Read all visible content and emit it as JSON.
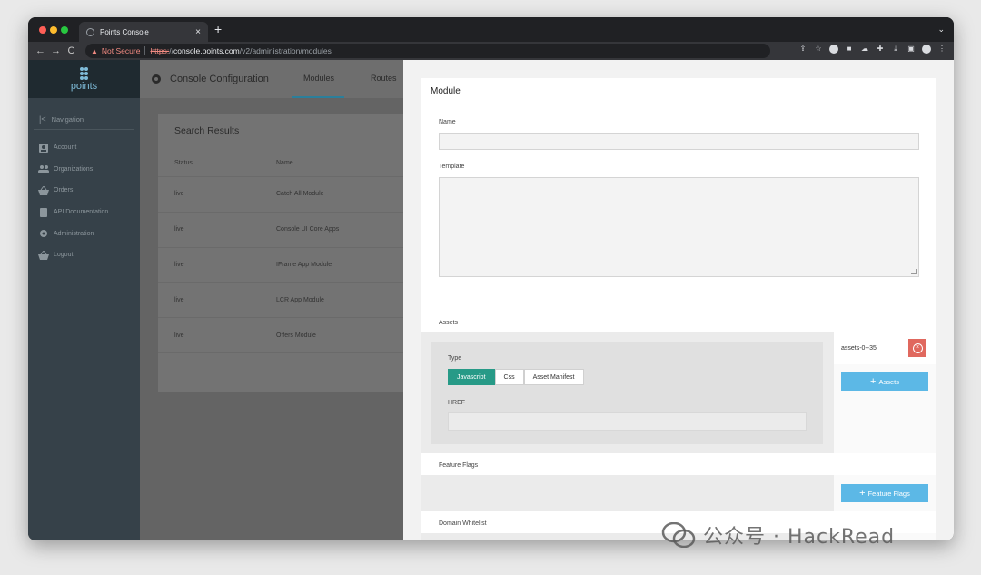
{
  "browser": {
    "tab_title": "Points Console",
    "tab_close": "×",
    "new_tab": "+",
    "tab_menu": "⌄",
    "back": "←",
    "forward": "→",
    "reload": "C",
    "security_text": "Not Secure",
    "url_scheme": "https:",
    "url_sep": "//",
    "url_host": "console.points.com",
    "url_path": "/v2/administration/modules"
  },
  "sidebar": {
    "logo_text": "points",
    "nav_label": "Navigation",
    "items": [
      {
        "label": "Account",
        "icon": "account-icon"
      },
      {
        "label": "Organizations",
        "icon": "organizations-icon"
      },
      {
        "label": "Orders",
        "icon": "orders-icon"
      },
      {
        "label": "API Documentation",
        "icon": "documentation-icon"
      },
      {
        "label": "Administration",
        "icon": "gear-icon"
      },
      {
        "label": "Logout",
        "icon": "logout-icon"
      }
    ]
  },
  "header": {
    "title": "Console Configuration",
    "tabs": [
      {
        "label": "Modules",
        "active": true
      },
      {
        "label": "Routes",
        "active": false
      }
    ]
  },
  "results": {
    "title": "Search Results",
    "columns": [
      "Status",
      "Name"
    ],
    "rows": [
      {
        "status": "live",
        "name": "Catch All Module"
      },
      {
        "status": "live",
        "name": "Console UI Core Apps"
      },
      {
        "status": "live",
        "name": "IFrame App Module"
      },
      {
        "status": "live",
        "name": "LCR App Module"
      },
      {
        "status": "live",
        "name": "Offers Module"
      }
    ]
  },
  "modal": {
    "title": "Module",
    "name_label": "Name",
    "name_value": "",
    "template_label": "Template",
    "template_value": "",
    "assets_label": "Assets",
    "type_label": "Type",
    "type_options": [
      "Javascript",
      "Css",
      "Asset Manifest"
    ],
    "type_selected": "Javascript",
    "href_label": "HREF",
    "href_value": "",
    "asset_chip": "assets-0--35",
    "add_assets": "Assets",
    "feature_flags_label": "Feature Flags",
    "add_feature_flags": "Feature Flags",
    "domain_whitelist_label": "Domain Whitelist"
  },
  "watermark": {
    "text": "公众号 · HackRead"
  },
  "colors": {
    "accent_teal": "#279a87",
    "add_button": "#5cb8e6",
    "remove_button": "#e0685e",
    "sidebar": "#364149"
  }
}
